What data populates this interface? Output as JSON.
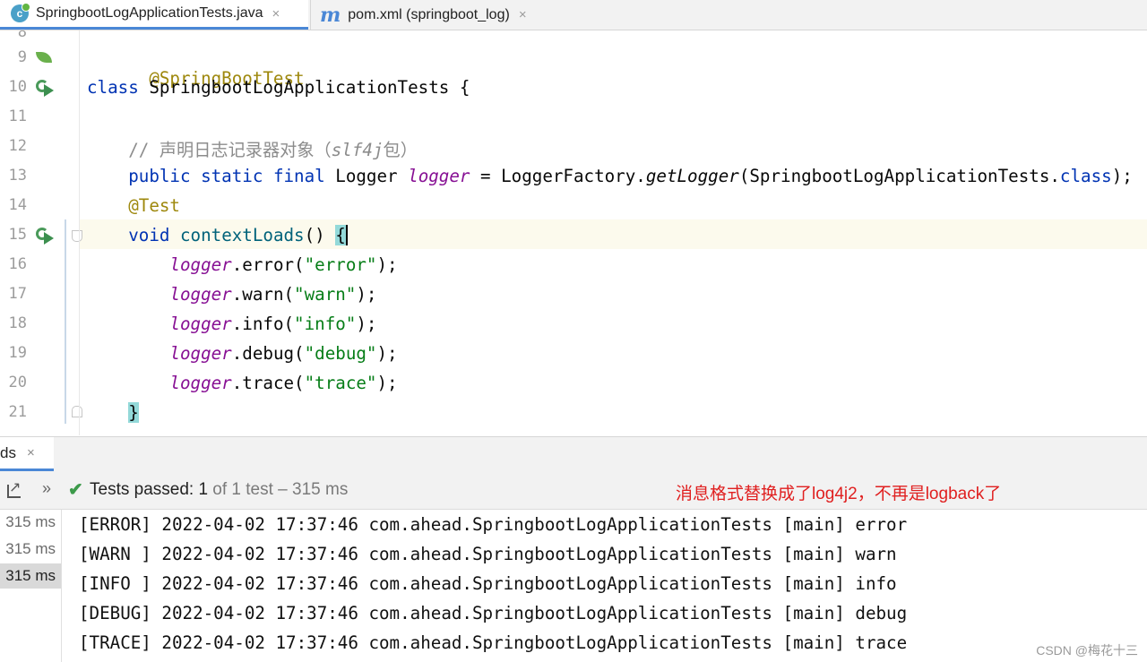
{
  "tabs": [
    {
      "label": "SpringbootLogApplicationTests.java",
      "icon": "class-c-icon",
      "active": true
    },
    {
      "label": "pom.xml (springboot_log)",
      "icon": "maven-m-icon",
      "active": false
    }
  ],
  "tab_close_glyph": "×",
  "maven_glyph": "m",
  "class_glyph": "c",
  "editor": {
    "line_numbers": [
      "9",
      "10",
      "11",
      "12",
      "13",
      "14",
      "15",
      "16",
      "17",
      "18",
      "19",
      "20",
      "21"
    ],
    "partial_line_number": "8",
    "lines": {
      "l9_annotation": "@SpringBootTest",
      "l10_keyword": "class",
      "l10_rest": " SpringbootLogApplicationTests {",
      "l12_comment": "// 声明日志记录器对象（",
      "l12_comment_italic": "slf4j",
      "l12_comment_end": "包）",
      "l13_kw": "public static final",
      "l13_type": " Logger ",
      "l13_field": "logger",
      "l13_mid": " = LoggerFactory.",
      "l13_method": "getLogger",
      "l13_arg": "(SpringbootLogApplicationTests.",
      "l13_class_kw": "class",
      "l13_end": ");",
      "l14_annotation": "@Test",
      "l15_kw": "void",
      "l15_method": " contextLoads",
      "l15_paren": "() ",
      "l15_brace": "{",
      "l21_brace": "}",
      "calls": [
        {
          "field": "logger",
          "method": ".error(",
          "arg": "\"error\"",
          "end": ");"
        },
        {
          "field": "logger",
          "method": ".warn(",
          "arg": "\"warn\"",
          "end": ");"
        },
        {
          "field": "logger",
          "method": ".info(",
          "arg": "\"info\"",
          "end": ");"
        },
        {
          "field": "logger",
          "method": ".debug(",
          "arg": "\"debug\"",
          "end": ");"
        },
        {
          "field": "logger",
          "method": ".trace(",
          "arg": "\"trace\"",
          "end": ");"
        }
      ]
    }
  },
  "run_panel": {
    "tab_label": "ds",
    "tab_close": "×",
    "more_glyph": "»",
    "check_glyph": "✔",
    "status_prefix": "Tests passed: ",
    "status_count": "1",
    "status_rest": " of 1 test – 315 ms",
    "annotation": "消息格式替换成了log4j2，不再是logback了",
    "durations": [
      "315 ms",
      "315 ms",
      "315 ms"
    ],
    "output": [
      "[ERROR] 2022-04-02 17:37:46 com.ahead.SpringbootLogApplicationTests [main] error",
      "[WARN ] 2022-04-02 17:37:46 com.ahead.SpringbootLogApplicationTests [main] warn",
      "[INFO ] 2022-04-02 17:37:46 com.ahead.SpringbootLogApplicationTests [main] info",
      "[DEBUG] 2022-04-02 17:37:46 com.ahead.SpringbootLogApplicationTests [main] debug",
      "[TRACE] 2022-04-02 17:37:46 com.ahead.SpringbootLogApplicationTests [main] trace"
    ]
  },
  "watermark": "CSDN @梅花十三",
  "colors": {
    "annotation": "#9e880d",
    "keyword": "#0033b3",
    "field": "#871094",
    "string": "#067d17",
    "method": "#00627a",
    "annotation_red": "#e02020",
    "pass_green": "#3c9a4a",
    "tab_accent": "#4a87d6"
  }
}
